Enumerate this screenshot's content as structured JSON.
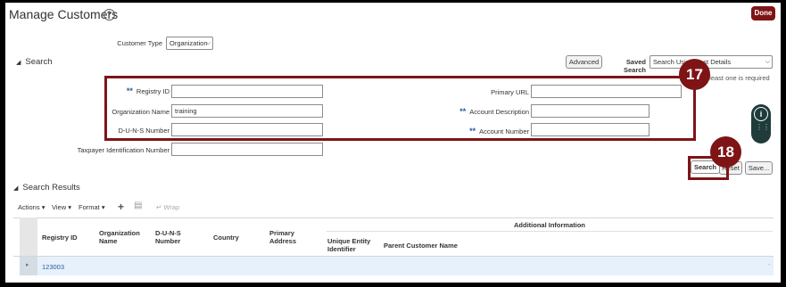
{
  "page": {
    "title": "Manage Customers",
    "done_label": "Done"
  },
  "customer_type": {
    "label": "Customer Type",
    "value": "Organization"
  },
  "search": {
    "section_title": "Search",
    "advanced_label": "Advanced",
    "saved_search_label": "Saved Search",
    "saved_search_value": "Search Using Best Details",
    "hint": "At least one is required",
    "required_marker": "**",
    "fields": {
      "registry_id": {
        "label": "Registry ID",
        "value": ""
      },
      "organization_name": {
        "label": "Organization Name",
        "value": "training"
      },
      "duns_number": {
        "label": "D-U-N-S Number",
        "value": ""
      },
      "taxpayer_id": {
        "label": "Taxpayer Identification Number",
        "value": ""
      },
      "primary_url": {
        "label": "Primary URL",
        "value": ""
      },
      "account_description": {
        "label": "Account Description",
        "value": ""
      },
      "account_number": {
        "label": "Account Number",
        "value": ""
      }
    },
    "search_button": "Search",
    "reset_button": "Reset",
    "save_button": "Save..."
  },
  "callouts": {
    "step_17": "17",
    "step_18": "18",
    "color": "#7f1416"
  },
  "results": {
    "section_title": "Search Results",
    "toolbar": {
      "actions": "Actions",
      "view": "View",
      "format": "Format",
      "wrap": "Wrap"
    },
    "group_header": "Additional Information",
    "columns": [
      "Registry ID",
      "Organization Name",
      "D-U-N-S Number",
      "Country",
      "Primary Address",
      "Unique Entity Identifier",
      "Parent Customer Name"
    ],
    "rows": [
      {
        "registry_id": "123003"
      }
    ]
  },
  "icons": [
    "help-icon",
    "add-icon",
    "detach-icon",
    "wrap-icon",
    "chevron-down-icon",
    "expand-row-icon",
    "accessibility-icon",
    "keypad-icon"
  ]
}
